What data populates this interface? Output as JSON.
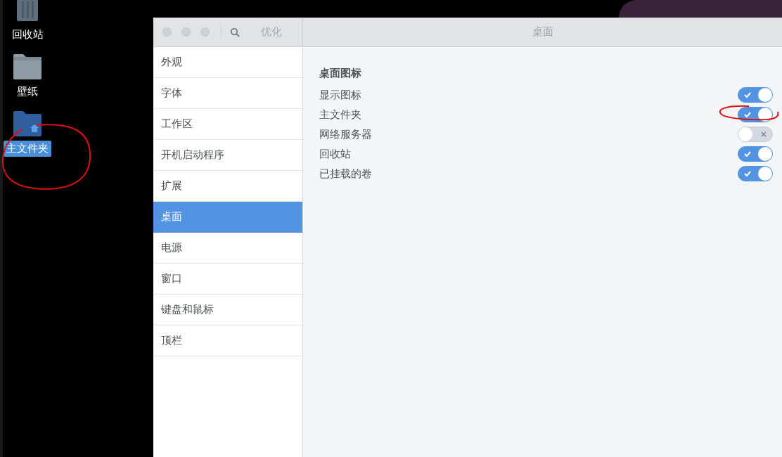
{
  "desktop": {
    "icons": [
      {
        "kind": "trash",
        "label": "回收站",
        "selected": false
      },
      {
        "kind": "folder",
        "label": "壁纸",
        "selected": false
      },
      {
        "kind": "home",
        "label": "主文件夹",
        "selected": true
      }
    ]
  },
  "window": {
    "app_title": "优化",
    "page_title": "桌面"
  },
  "sidebar": {
    "items": [
      {
        "label": "外观",
        "selected": false
      },
      {
        "label": "字体",
        "selected": false
      },
      {
        "label": "工作区",
        "selected": false
      },
      {
        "label": "开机启动程序",
        "selected": false
      },
      {
        "label": "扩展",
        "selected": false
      },
      {
        "label": "桌面",
        "selected": true
      },
      {
        "label": "电源",
        "selected": false
      },
      {
        "label": "窗口",
        "selected": false
      },
      {
        "label": "键盘和鼠标",
        "selected": false
      },
      {
        "label": "顶栏",
        "selected": false
      }
    ]
  },
  "section": {
    "heading": "桌面图标",
    "settings": [
      {
        "label": "显示图标",
        "on": true
      },
      {
        "label": "主文件夹",
        "on": true
      },
      {
        "label": "网络服务器",
        "on": false
      },
      {
        "label": "回收站",
        "on": true
      },
      {
        "label": "已挂载的卷",
        "on": true
      }
    ]
  }
}
